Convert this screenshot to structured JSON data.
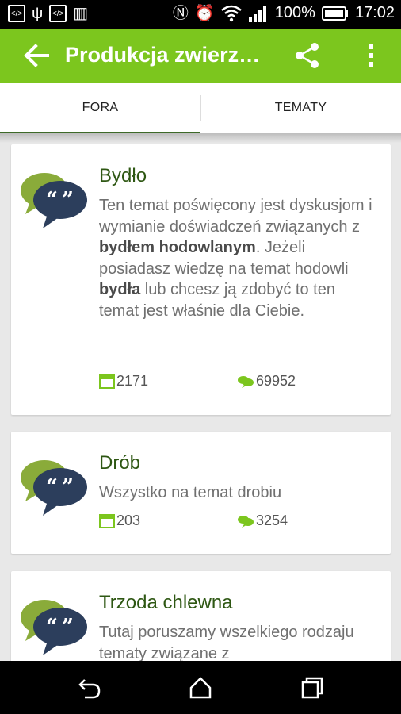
{
  "status_bar": {
    "battery_percent": "100%",
    "time": "17:02",
    "icons": [
      "code-icon",
      "usb-icon",
      "code-icon",
      "barcode-icon",
      "nfc-icon",
      "alarm-icon",
      "wifi-icon",
      "signal-icon",
      "battery-icon"
    ]
  },
  "app_bar": {
    "title": "Produkcja zwierzę…",
    "color": "#7cc61e"
  },
  "tabs": [
    {
      "label": "FORA",
      "active": true
    },
    {
      "label": "TEMATY",
      "active": false
    }
  ],
  "forums": [
    {
      "title": "Bydło",
      "desc_parts": [
        "Ten temat poświęcony jest dyskusjom i wymianie doświadczeń związanych z ",
        "bydłem hodowlanym",
        ". Jeżeli posiadasz wiedzę na temat hodowli ",
        "bydła",
        " lub chcesz ją zdobyć to ten temat jest właśnie dla Ciebie."
      ],
      "topics": "2171",
      "posts": "69952"
    },
    {
      "title": "Drób",
      "desc": "Wszystko na temat drobiu",
      "topics": "203",
      "posts": "3254"
    },
    {
      "title": "Trzoda chlewna",
      "desc": "Tutaj poruszamy wszelkiego rodzaju tematy związane z"
    }
  ]
}
